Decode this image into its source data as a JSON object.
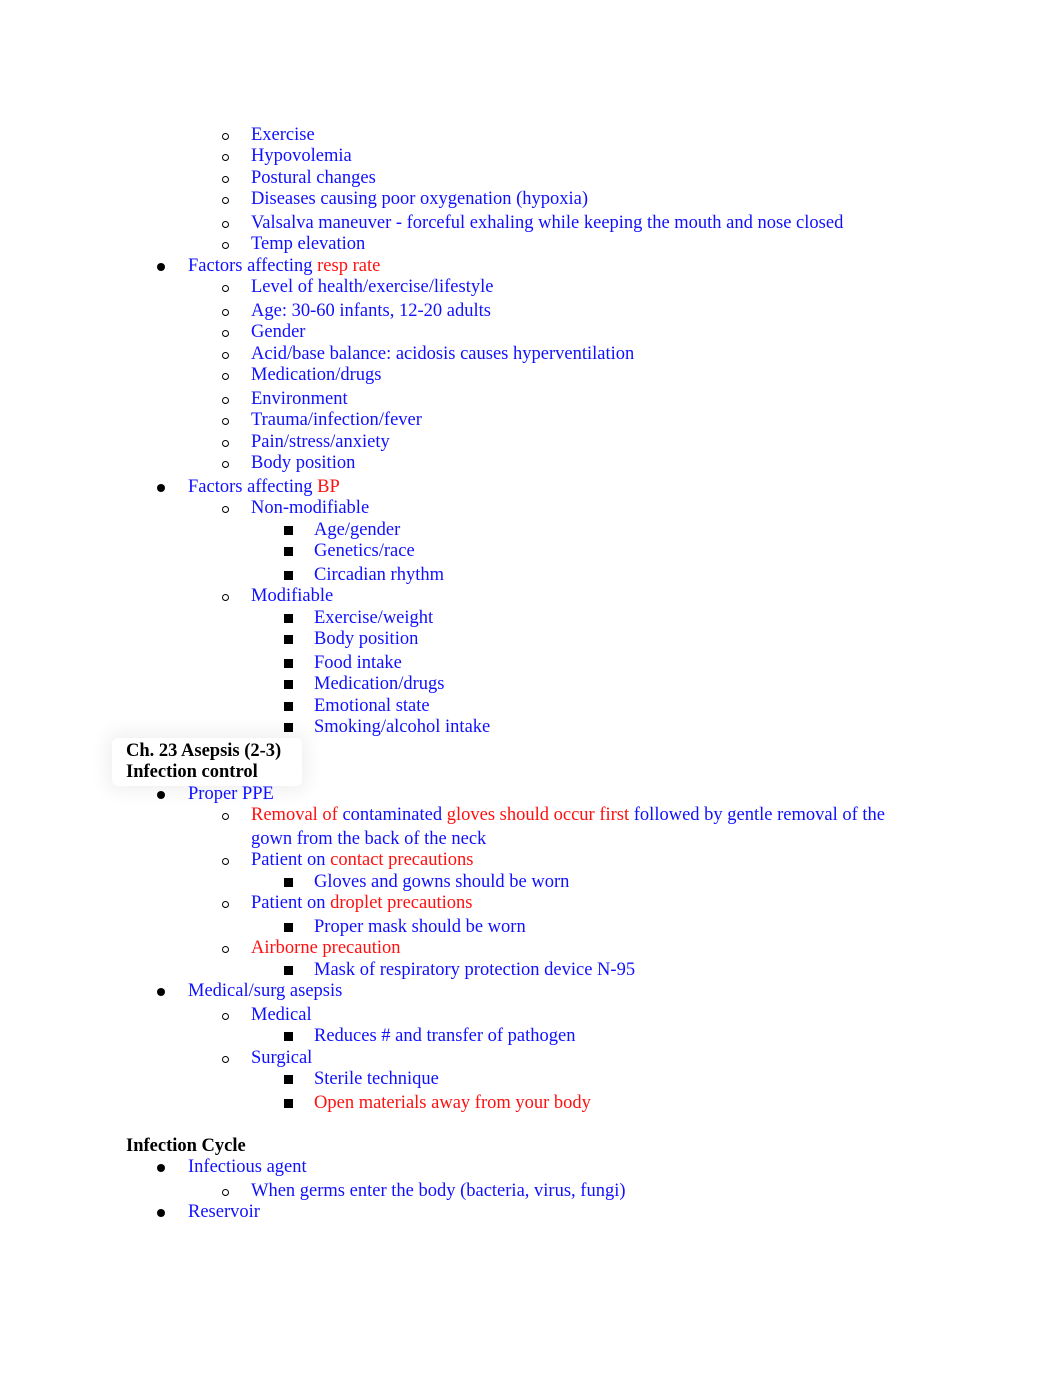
{
  "document": {
    "colors": {
      "body_text": "#1010ff",
      "highlight": "#ff1010",
      "heading": "#000000"
    },
    "bullets": {
      "level1": "filled-circle",
      "level2": "hollow-circle",
      "level3": "filled-square"
    },
    "lines": [
      {
        "level": 2,
        "segments": [
          {
            "text": "Exercise",
            "color": "blue"
          }
        ]
      },
      {
        "level": 2,
        "segments": [
          {
            "text": "Hypovolemia",
            "color": "blue"
          }
        ]
      },
      {
        "level": 2,
        "segments": [
          {
            "text": "Postural changes",
            "color": "blue"
          }
        ]
      },
      {
        "level": 2,
        "segments": [
          {
            "text": "Diseases causing poor oxygenation (hypoxia)",
            "color": "blue"
          }
        ]
      },
      {
        "level": 2,
        "segments": [
          {
            "text": "Valsalva maneuver - forceful exhaling while keeping the mouth and nose closed",
            "color": "blue"
          }
        ]
      },
      {
        "level": 2,
        "segments": [
          {
            "text": "Temp elevation",
            "color": "blue"
          }
        ]
      },
      {
        "level": 1,
        "segments": [
          {
            "text": "Factors affecting ",
            "color": "blue"
          },
          {
            "text": "resp rate",
            "color": "red"
          }
        ]
      },
      {
        "level": 2,
        "segments": [
          {
            "text": "Level of health/exercise/lifestyle",
            "color": "blue"
          }
        ]
      },
      {
        "level": 2,
        "segments": [
          {
            "text": "Age: 30-60 infants, 12-20 adults",
            "color": "blue"
          }
        ]
      },
      {
        "level": 2,
        "segments": [
          {
            "text": "Gender",
            "color": "blue"
          }
        ]
      },
      {
        "level": 2,
        "segments": [
          {
            "text": "Acid/base balance: acidosis causes hyperventilation",
            "color": "blue"
          }
        ]
      },
      {
        "level": 2,
        "segments": [
          {
            "text": "Medication/drugs",
            "color": "blue"
          }
        ]
      },
      {
        "level": 2,
        "segments": [
          {
            "text": "Environment",
            "color": "blue"
          }
        ]
      },
      {
        "level": 2,
        "segments": [
          {
            "text": "Trauma/infection/fever",
            "color": "blue"
          }
        ]
      },
      {
        "level": 2,
        "segments": [
          {
            "text": "Pain/stress/anxiety",
            "color": "blue"
          }
        ]
      },
      {
        "level": 2,
        "segments": [
          {
            "text": "Body position",
            "color": "blue"
          }
        ]
      },
      {
        "level": 1,
        "segments": [
          {
            "text": "Factors affecting ",
            "color": "blue"
          },
          {
            "text": "BP",
            "color": "red"
          }
        ]
      },
      {
        "level": 2,
        "segments": [
          {
            "text": "Non-modifiable",
            "color": "blue"
          }
        ]
      },
      {
        "level": 3,
        "segments": [
          {
            "text": "Age/gender",
            "color": "blue"
          }
        ]
      },
      {
        "level": 3,
        "segments": [
          {
            "text": "Genetics/race",
            "color": "blue"
          }
        ]
      },
      {
        "level": 3,
        "segments": [
          {
            "text": "Circadian rhythm",
            "color": "blue"
          }
        ]
      },
      {
        "level": 2,
        "segments": [
          {
            "text": "Modifiable",
            "color": "blue"
          }
        ]
      },
      {
        "level": 3,
        "segments": [
          {
            "text": "Exercise/weight",
            "color": "blue"
          }
        ]
      },
      {
        "level": 3,
        "segments": [
          {
            "text": "Body position",
            "color": "blue"
          }
        ]
      },
      {
        "level": 3,
        "segments": [
          {
            "text": "Food intake",
            "color": "blue"
          }
        ]
      },
      {
        "level": 3,
        "segments": [
          {
            "text": "Medication/drugs",
            "color": "blue"
          }
        ]
      },
      {
        "level": 3,
        "segments": [
          {
            "text": "Emotional state",
            "color": "blue"
          }
        ]
      },
      {
        "level": 3,
        "segments": [
          {
            "text": "Smoking/alcohol intake",
            "color": "blue"
          }
        ]
      },
      {
        "level": 0,
        "heading": true,
        "segments": [
          {
            "text": "Ch. 23 Asepsis (2-3)",
            "color": "black"
          }
        ]
      },
      {
        "level": 0,
        "heading": true,
        "segments": [
          {
            "text": "Infection control",
            "color": "black"
          }
        ]
      },
      {
        "level": 1,
        "segments": [
          {
            "text": "Proper PPE",
            "color": "blue"
          }
        ]
      },
      {
        "level": 2,
        "segments": [
          {
            "text": "Removal of ",
            "color": "red"
          },
          {
            "text": "contaminated ",
            "color": "blue"
          },
          {
            "text": "gloves should occur first",
            "color": "red"
          },
          {
            "text": " followed by gentle removal of the",
            "color": "blue"
          }
        ]
      },
      {
        "level": 2,
        "continuation": true,
        "segments": [
          {
            "text": "gown from the back of the neck",
            "color": "blue"
          }
        ]
      },
      {
        "level": 2,
        "segments": [
          {
            "text": "Patient on ",
            "color": "blue"
          },
          {
            "text": "contact precautions",
            "color": "red"
          }
        ]
      },
      {
        "level": 3,
        "segments": [
          {
            "text": "Gloves and gowns should be worn",
            "color": "blue"
          }
        ]
      },
      {
        "level": 2,
        "segments": [
          {
            "text": "Patient on ",
            "color": "blue"
          },
          {
            "text": "droplet precautions",
            "color": "red"
          }
        ]
      },
      {
        "level": 3,
        "segments": [
          {
            "text": "Proper mask should be worn",
            "color": "blue"
          }
        ]
      },
      {
        "level": 2,
        "segments": [
          {
            "text": "Airborne precaution",
            "color": "red"
          }
        ]
      },
      {
        "level": 3,
        "segments": [
          {
            "text": "Mask of respiratory protection device N-95",
            "color": "blue"
          }
        ]
      },
      {
        "level": 1,
        "segments": [
          {
            "text": "Medical/surg asepsis",
            "color": "blue"
          }
        ]
      },
      {
        "level": 2,
        "segments": [
          {
            "text": "Medical",
            "color": "blue"
          }
        ]
      },
      {
        "level": 3,
        "segments": [
          {
            "text": "Reduces # and transfer of pathogen",
            "color": "blue"
          }
        ]
      },
      {
        "level": 2,
        "segments": [
          {
            "text": "Surgical",
            "color": "blue"
          }
        ]
      },
      {
        "level": 3,
        "segments": [
          {
            "text": "Sterile technique",
            "color": "blue"
          }
        ]
      },
      {
        "level": 3,
        "segments": [
          {
            "text": "Open materials away from your body",
            "color": "red"
          }
        ]
      },
      {
        "level": 0,
        "heading": true,
        "segments": [
          {
            "text": "Infection Cycle",
            "color": "black"
          }
        ]
      },
      {
        "level": 1,
        "segments": [
          {
            "text": "Infectious agent",
            "color": "blue"
          }
        ]
      },
      {
        "level": 2,
        "segments": [
          {
            "text": "When germs enter the body (bacteria, virus, fungi)",
            "color": "blue"
          }
        ]
      },
      {
        "level": 1,
        "segments": [
          {
            "text": "Reservoir",
            "color": "blue"
          }
        ]
      }
    ]
  }
}
